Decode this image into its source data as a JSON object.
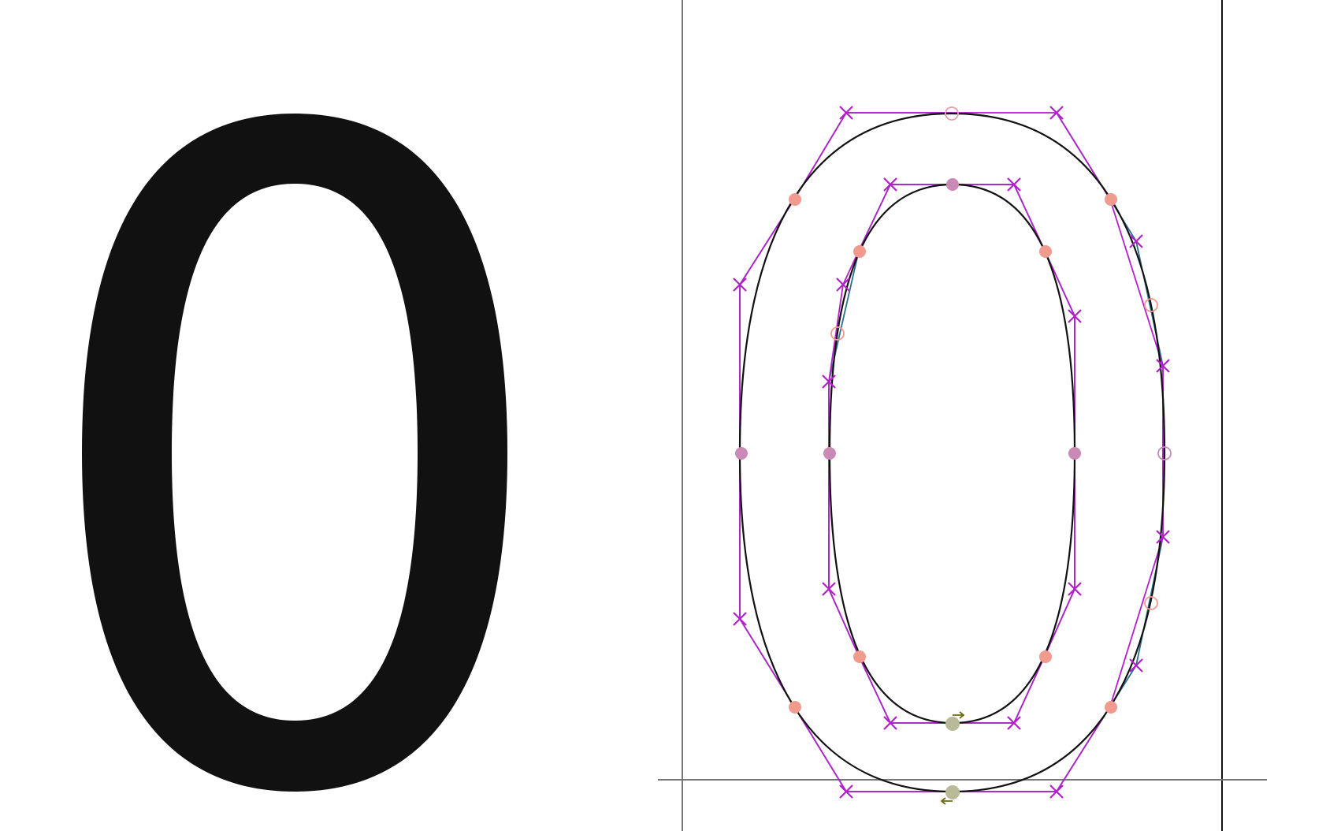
{
  "glyph": {
    "character": "0",
    "fill_color": "#111111"
  },
  "editor": {
    "colors": {
      "contour": "#111111",
      "metric_line": "#777777",
      "advance_line": "#111111",
      "handle_line_teal": "#2a6f8f",
      "handle_line_magenta": "#b41fcc",
      "off_curve_marker": "#b41fcc",
      "on_curve_smooth": "#f19a8e",
      "on_curve_extreme": "#c98ab8",
      "start_point": "#b9bb98",
      "direction_arrow": "#6b6b10"
    },
    "point_types": {
      "off_curve": "x-mark",
      "on_curve_smooth": "filled-circle",
      "on_curve_open": "hollow-circle",
      "start_point": "olive-circle-with-arrow"
    }
  }
}
